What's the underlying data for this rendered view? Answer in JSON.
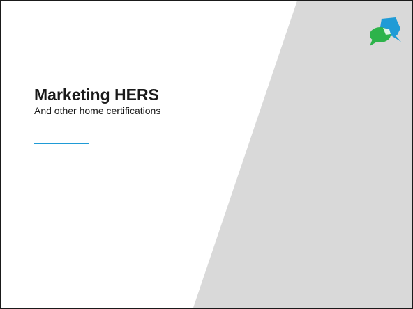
{
  "slide": {
    "title": "Marketing HERS",
    "subtitle": "And other home certifications"
  },
  "colors": {
    "background": "#ffffff",
    "panel": "#d9d9d9",
    "accent": "#1f9bd6",
    "logo_blue": "#1f9bd6",
    "logo_green": "#2db34a",
    "text": "#1a1a1a"
  },
  "icons": {
    "logo": "speech-bubbles-logo-icon"
  }
}
